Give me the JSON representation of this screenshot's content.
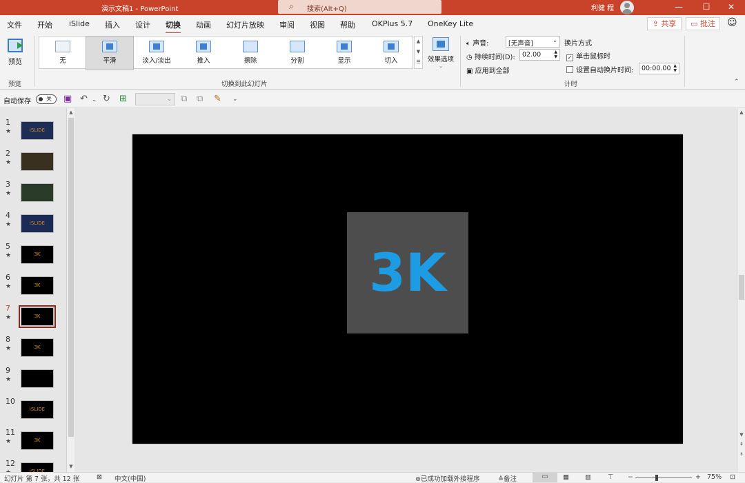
{
  "titlebar": {
    "doc_title": "演示文稿1  -  PowerPoint",
    "search_placeholder": "搜索(Alt+Q)",
    "user_name": "利健 程",
    "min": "—",
    "max": "☐",
    "close": "✕"
  },
  "menu": {
    "tabs": [
      "文件",
      "开始",
      "iSlide",
      "插入",
      "设计",
      "切换",
      "动画",
      "幻灯片放映",
      "审阅",
      "视图",
      "帮助",
      "OKPlus 5.7",
      "OneKey Lite"
    ],
    "active_tab": "切换",
    "share": "共享",
    "comment": "批注"
  },
  "ribbon": {
    "preview_label": "预览",
    "preview_group": "预览",
    "transitions": [
      "无",
      "平滑",
      "淡入/淡出",
      "推入",
      "擦除",
      "分割",
      "显示",
      "切入"
    ],
    "selected_transition": "平滑",
    "gallery_group": "切换到此幻灯片",
    "effects_label": "效果选项",
    "sound_label": "声音:",
    "sound_value": "[无声音]",
    "duration_label": "持续时间(D):",
    "duration_value": "02.00",
    "apply_all": "应用到全部",
    "advance_title": "换片方式",
    "on_click": "单击鼠标时",
    "on_click_checked": true,
    "auto_after": "设置自动换片时间:",
    "auto_after_value": "00:00.00",
    "timing_group": "计时"
  },
  "qat": {
    "autosave": "自动保存",
    "toggle_state": "关"
  },
  "slides": [
    {
      "num": "1",
      "star": true,
      "caption": "iSLIDE"
    },
    {
      "num": "2",
      "star": true,
      "caption": ""
    },
    {
      "num": "3",
      "star": true,
      "caption": ""
    },
    {
      "num": "4",
      "star": true,
      "caption": "iSLIDE"
    },
    {
      "num": "5",
      "star": true,
      "caption": "3K"
    },
    {
      "num": "6",
      "star": true,
      "caption": "3K"
    },
    {
      "num": "7",
      "star": true,
      "caption": "3K"
    },
    {
      "num": "8",
      "star": true,
      "caption": "3K"
    },
    {
      "num": "9",
      "star": true,
      "caption": ""
    },
    {
      "num": "10",
      "star": false,
      "caption": "iSLIDE"
    },
    {
      "num": "11",
      "star": true,
      "caption": "3K"
    },
    {
      "num": "12",
      "star": true,
      "caption": "iSLIDE"
    }
  ],
  "current_slide": "7",
  "slide_content": {
    "logo_text": "3K",
    "logo_color": "#1d9be3",
    "box_color": "#4d4d4d"
  },
  "status": {
    "slide_info": "幻灯片 第 7 张，共 12 张",
    "language": "中文(中国)",
    "addins": "已成功加载外接程序",
    "notes": "备注",
    "zoom_minus": "−",
    "zoom_plus": "+",
    "zoom": "75%"
  }
}
